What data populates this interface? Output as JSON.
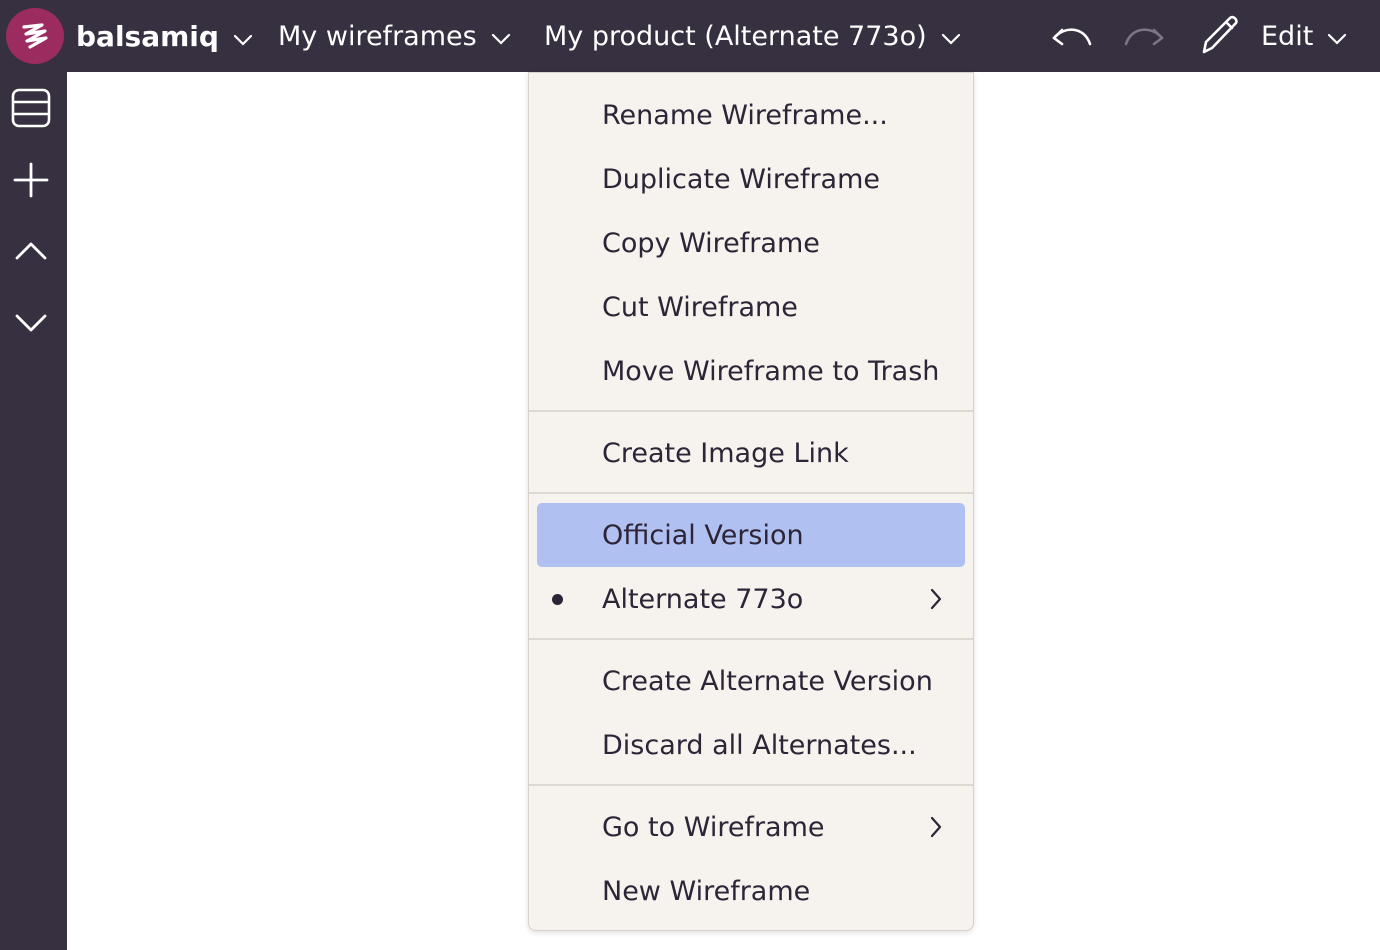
{
  "topbar": {
    "brand": "balsamiq",
    "project": "My wireframes",
    "wireframe": "My product (Alternate 773o)",
    "edit": "Edit",
    "icons": [
      "balsamiq-logo-icon",
      "chevron-down-icon",
      "undo-icon",
      "redo-icon",
      "pencil-icon"
    ]
  },
  "sidebar": {
    "icons": [
      "list-icon",
      "plus-icon",
      "chevron-up-icon",
      "chevron-down-icon"
    ]
  },
  "menu": {
    "items": [
      "Rename Wireframe...",
      "Duplicate Wireframe",
      "Copy Wireframe",
      "Cut Wireframe",
      "Move Wireframe to Trash",
      "Create Image Link",
      "Official Version",
      "Alternate 773o",
      "Create Alternate Version",
      "Discard all Alternates...",
      "Go to Wireframe",
      "New Wireframe"
    ],
    "highlight_color": "#b0c0f0"
  },
  "colors": {
    "chrome": "#363040",
    "logo": "#9c2c5f",
    "menu_bg": "#f6f2ed",
    "text": "#2d2437"
  }
}
